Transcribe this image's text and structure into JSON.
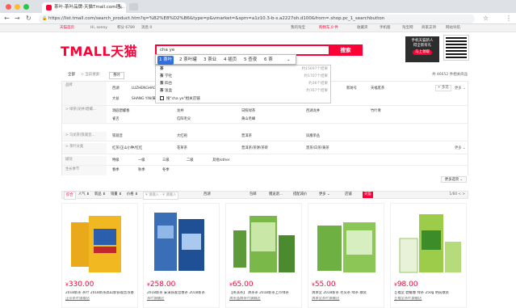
{
  "browser": {
    "tab_title": "茶叶-茶叶品牌-天猫Tmall.com理...",
    "url": "https://list.tmall.com/search_product.htm?q=%B2%E8%D2%B6&type=p&vmarket=&spm=a1z10.3-b-s.a2227oh.d100&from=.shop.pc_1_searchbutton",
    "back_icon": "←",
    "forward_icon": "→",
    "reload_icon": "↻",
    "star_icon": "☆",
    "menu_icon": "⋮"
  },
  "site_top": {
    "home": "天猫首页",
    "greeting": "Hi, sonny",
    "points": "积分 6789",
    "messages": "消息 0",
    "my_tmall": "我的淘宝",
    "cart": "购物车 0 件",
    "favorites": "收藏夹",
    "mobile": "手机版",
    "taobao": "淘宝网",
    "merchant": "商家支持",
    "sitemap": "网站导航"
  },
  "header": {
    "logo": "TMALL天猫",
    "search_value": "cha ye",
    "search_button": "搜索",
    "promo_line1": "手机天猫新人",
    "promo_line2": "得全新有礼",
    "promo_button": "马上领取"
  },
  "ime": {
    "candidates": [
      "1 茶叶",
      "2 茶叶罐",
      "3 茶业",
      "4 插页",
      "5 查夜",
      "6 茶"
    ],
    "selected_index": 0,
    "expand_icon": "⌄"
  },
  "suggestions": [
    {
      "keyword": "茶 ",
      "term": "",
      "count": "约15697个结果"
    },
    {
      "keyword": "茶 ",
      "term": "学社",
      "count": "约1707个结果"
    },
    {
      "keyword": "茶 ",
      "term": "四台",
      "count": "约36个结果"
    },
    {
      "keyword": "茶 ",
      "term": "饭盒",
      "count": "约767个结果"
    },
    {
      "keyword": "",
      "term": "搜\"cha ye\"相关店铺",
      "count": ""
    }
  ],
  "breadcrumb": {
    "all": "全部",
    "keyword_label": "> 当前搜索:",
    "keyword": "茶叶",
    "result_count": "共 46652 件相关商品"
  },
  "filter": {
    "brand_label": "品牌",
    "brands_row1": [
      "西湖",
      "LUZHENGHAOF",
      "",
      "",
      "",
      "",
      "",
      "...TEA/小罐茶",
      "新坊号",
      "天福茗茶"
    ],
    "brands_row2": [
      "大益",
      "SHANG YIN/黄...",
      "",
      "",
      "",
      "",
      "",
      ""
    ],
    "multi_select": "+ 多选",
    "more": "更多 ⌄",
    "rows": [
      {
        "label": "> 绿茶(龙井/碧螺...",
        "values": [
          "洞庭碧螺春",
          "龙井",
          "日照绿茶",
          "西湖龙井",
          "竹叶青"
        ],
        "more": ""
      },
      {
        "label": "",
        "values": [
          "雀舌",
          "信阳毛尖",
          "黄山毛峰"
        ],
        "more": ""
      },
      {
        "label": "> 乌龙茶(铁观音...",
        "values": [
          "铁观音",
          "大红袍",
          "普洱茶",
          "凤凰单丛"
        ],
        "more": ""
      },
      {
        "label": "> 茶叶分类",
        "values": [
          "红茶/正山小种/红红",
          "花草茶",
          "普洱茶/茶饼/茶砖",
          "黑茶/白茶/黄茶"
        ],
        "more": "更多 ⌄"
      },
      {
        "label": "级别",
        "values": [
          "特级",
          "一级",
          "三级",
          "二级",
          "其他/other"
        ],
        "more": ""
      },
      {
        "label": "生长季节",
        "values": [
          "春季",
          "秋季",
          "冬季"
        ],
        "more": ""
      }
    ],
    "collapse_label": "更多选项 ⌄"
  },
  "sortbar": {
    "items": [
      "综合",
      "人气 ⬇",
      "新品 ⬇",
      "销量 ⬇",
      "价格 ⬇"
    ],
    "price_placeholder": "¥ 请输入 - ¥ 请输入",
    "location": "西湖",
    "options": [
      "包邮",
      "赠送退...",
      "搭配减价",
      "更多 ⌄"
    ],
    "view_store": "店铺",
    "view_tmall": "天猫",
    "pager": "1/60 < >"
  },
  "products": [
    {
      "price": "330.00",
      "title": "2018新茶 茶叶 2018新茶高山新铁观音浓香",
      "shop": "正宗茶叶旗舰店",
      "pkg": "gold"
    },
    {
      "price": "258.00",
      "title": "2018新茶 安溪铁观音春茶 2018新茶",
      "shop": "茶叶旗舰店",
      "pkg": "blue"
    },
    {
      "price": "65.00",
      "title": "【英派茶】 清茶茶 2018新茶上市绿茶",
      "shop": "清茶品牌茶叶旗舰店",
      "pkg": "green"
    },
    {
      "price": "55.00",
      "title": "清承堂 2018新茶 毛尖茶 绿茶 散装",
      "shop": "清承堂茶叶旗舰店",
      "pkg": "greenbox"
    },
    {
      "price": "98.00",
      "title": "艺福堂 碧螺春 绿茶 250g 明前散装",
      "shop": "艺福堂茶叶旗舰店",
      "pkg": "lime"
    }
  ],
  "colors": {
    "accent": "#ff0036",
    "ime_select": "#2f6fe0"
  }
}
